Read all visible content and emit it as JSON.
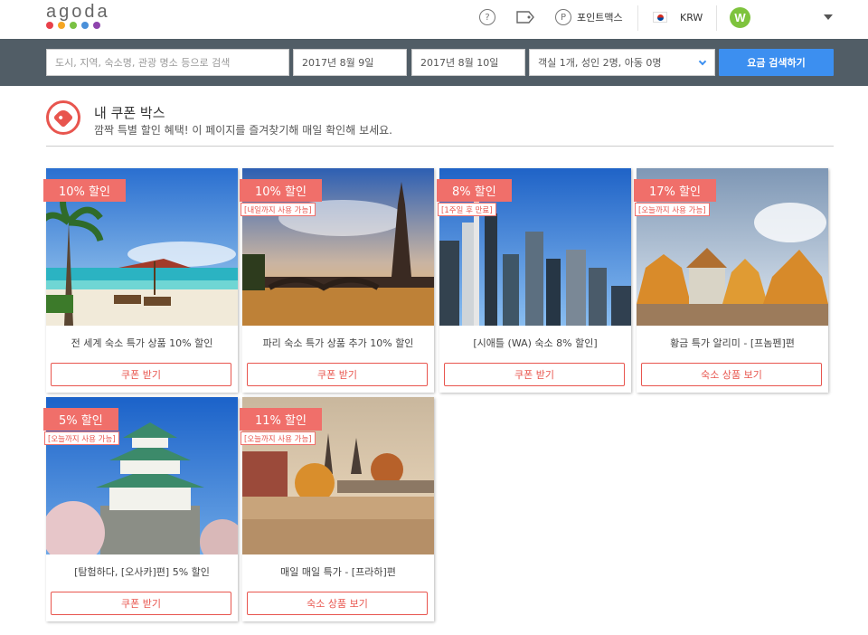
{
  "brand": {
    "name": "agoda",
    "dots": [
      "#e8404a",
      "#f5a623",
      "#7ac143",
      "#4a90d9",
      "#8e44ad"
    ]
  },
  "header": {
    "help_icon": "question-circle-icon",
    "tag_icon": "tag-icon",
    "points_label": "포인트맥스",
    "currency": "KRW",
    "avatar_initial": "W"
  },
  "search": {
    "destination_placeholder": "도시, 지역, 숙소명, 관광 명소 등으로 검색",
    "checkin": "2017년 8월 9일",
    "checkout": "2017년 8월 10일",
    "occupancy": "객실 1개, 성인 2명, 아동 0명",
    "submit_label": "요금 검색하기"
  },
  "page": {
    "title": "내 쿠폰 박스",
    "subtitle": "깜짝 특별 할인 혜택! 이 페이지를 즐겨찾기해 매일 확인해 보세요."
  },
  "colors": {
    "accent": "#e8554e",
    "badge": "#f06f6a",
    "search_bg": "#515d66",
    "search_button": "#3c8ff0"
  },
  "coupons": [
    {
      "discount": "10% 할인",
      "note": "",
      "title": "전 세계 숙소 특가 상품 10% 할인",
      "button": "쿠폰 받기"
    },
    {
      "discount": "10% 할인",
      "note": "[내일까지 사용 가능]",
      "title": "파리 숙소 특가 상품 추가 10% 할인",
      "button": "쿠폰 받기"
    },
    {
      "discount": "8% 할인",
      "note": "[1주일 후 만료]",
      "title": "[시애틀 (WA) 숙소 8% 할인]",
      "button": "쿠폰 받기"
    },
    {
      "discount": "17% 할인",
      "note": "[오늘까지 사용 가능]",
      "title": "황금 특가 알리미 - [프놈펜]편",
      "button": "숙소 상품 보기"
    },
    {
      "discount": "5% 할인",
      "note": "[오늘까지 사용 가능]",
      "title": "[탐험하다, [오사카]편] 5% 할인",
      "button": "쿠폰 받기"
    },
    {
      "discount": "11% 할인",
      "note": "[오늘까지 사용 가능]",
      "title": "매일 매일 특가 - [프라하]편",
      "button": "숙소 상품 보기"
    }
  ]
}
